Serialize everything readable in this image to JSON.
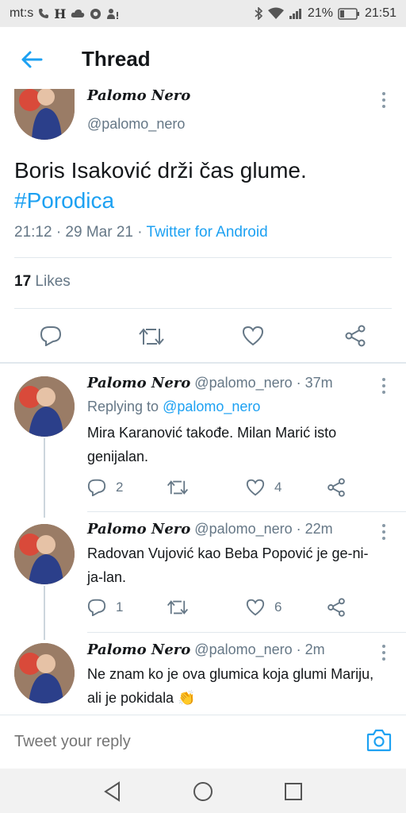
{
  "status_bar": {
    "left_text": "mt:s",
    "battery": "21%",
    "time": "21:51"
  },
  "app_bar": {
    "title": "Thread"
  },
  "main_tweet": {
    "name": "Palomo Nero",
    "handle": "@palomo_nero",
    "text": "Boris Isaković drži čas glume.",
    "hashtag": "#Porodica",
    "timestamp": "21:12 · 29 Mar 21 · ",
    "source": "Twitter for Android",
    "likes_count": "17",
    "likes_label": "Likes"
  },
  "replies": [
    {
      "name": "Palomo Nero",
      "meta": "@palomo_nero · 37m",
      "replying_prefix": "Replying to ",
      "replying_handle": "@palomo_nero",
      "text": "Mira Karanović takođe. Milan Marić isto genijalan.",
      "replies": "2",
      "likes": "4"
    },
    {
      "name": "Palomo Nero",
      "meta": "@palomo_nero · 22m",
      "text": "Radovan Vujović kao Beba Popović je ge-ni-ja-lan.",
      "replies": "1",
      "likes": "6"
    },
    {
      "name": "Palomo Nero",
      "meta": "@palomo_nero · 2m",
      "text": "Ne znam ko je ova glumica koja glumi Mariju, ali je pokidala 👏"
    }
  ],
  "reply_bar": {
    "placeholder": "Tweet your reply"
  },
  "colors": {
    "accent": "#1da1f2",
    "secondary": "#657786",
    "divider": "#e1e8ed"
  }
}
